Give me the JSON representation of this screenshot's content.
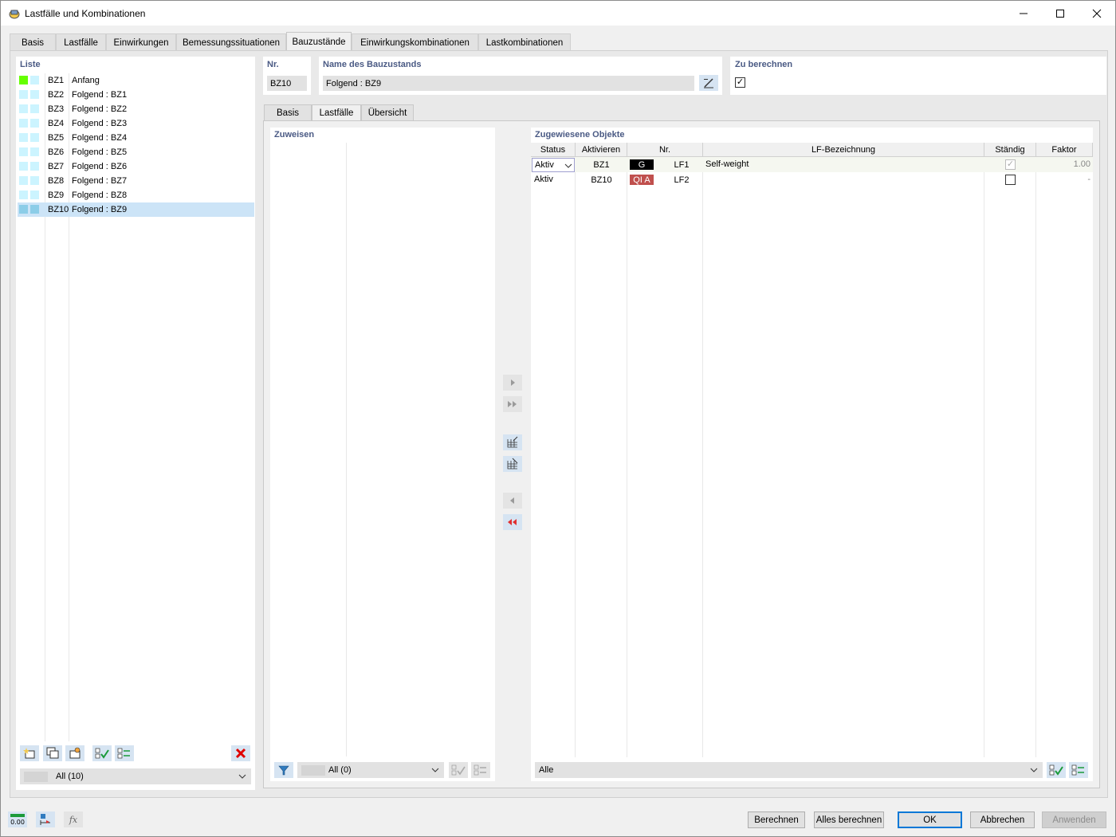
{
  "window": {
    "title": "Lastfälle und Kombinationen"
  },
  "main_tabs": [
    "Basis",
    "Lastfälle",
    "Einwirkungen",
    "Bemessungssituationen",
    "Bauzustände",
    "Einwirkungskombinationen",
    "Lastkombinationen"
  ],
  "list": {
    "header": "Liste",
    "items": [
      {
        "code": "BZ1",
        "name": "Anfang"
      },
      {
        "code": "BZ2",
        "name": "Folgend : BZ1"
      },
      {
        "code": "BZ3",
        "name": "Folgend : BZ2"
      },
      {
        "code": "BZ4",
        "name": "Folgend : BZ3"
      },
      {
        "code": "BZ5",
        "name": "Folgend : BZ4"
      },
      {
        "code": "BZ6",
        "name": "Folgend : BZ5"
      },
      {
        "code": "BZ7",
        "name": "Folgend : BZ6"
      },
      {
        "code": "BZ8",
        "name": "Folgend : BZ7"
      },
      {
        "code": "BZ9",
        "name": "Folgend : BZ8"
      },
      {
        "code": "BZ10",
        "name": "Folgend : BZ9"
      }
    ],
    "filter_value": "All (10)"
  },
  "detail": {
    "nr_label": "Nr.",
    "nr_value": "BZ10",
    "name_label": "Name des Bauzustands",
    "name_value": "Folgend : BZ9",
    "calc_label": "Zu berechnen",
    "calc_checked": "✓"
  },
  "sub_tabs": [
    "Basis",
    "Lastfälle",
    "Übersicht"
  ],
  "assign": {
    "header": "Zuweisen",
    "filter_value": "All (0)"
  },
  "assigned": {
    "header": "Zugewiesene Objekte",
    "columns": [
      "Status",
      "Aktivieren",
      "Nr.",
      "LF-Bezeichnung",
      "Ständig",
      "Faktor"
    ],
    "rows": [
      {
        "status": "Aktiv",
        "activate": "BZ1",
        "badge": "G",
        "nr": "LF1",
        "name": "Self-weight",
        "permanent": "✓",
        "factor": "1.00"
      },
      {
        "status": "Aktiv",
        "activate": "BZ10",
        "badge": "QI A",
        "nr": "LF2",
        "name": "",
        "permanent": "",
        "factor": "-"
      }
    ],
    "filter_value": "Alle"
  },
  "buttons": {
    "calc": "Berechnen",
    "calc_all": "Alles berechnen",
    "ok": "OK",
    "cancel": "Abbrechen",
    "apply": "Anwenden"
  },
  "status_icons": {
    "zero_value": "0.00",
    "fx": "fx"
  },
  "colors": {
    "accent_header": "#4a5a84",
    "selection": "#cce4f7",
    "bz1_marker": "#66ff00",
    "marker_cyan": "#ccf4ff",
    "badge_g": "#000000",
    "badge_q": "#c0504d",
    "delete_red": "#e00000"
  }
}
